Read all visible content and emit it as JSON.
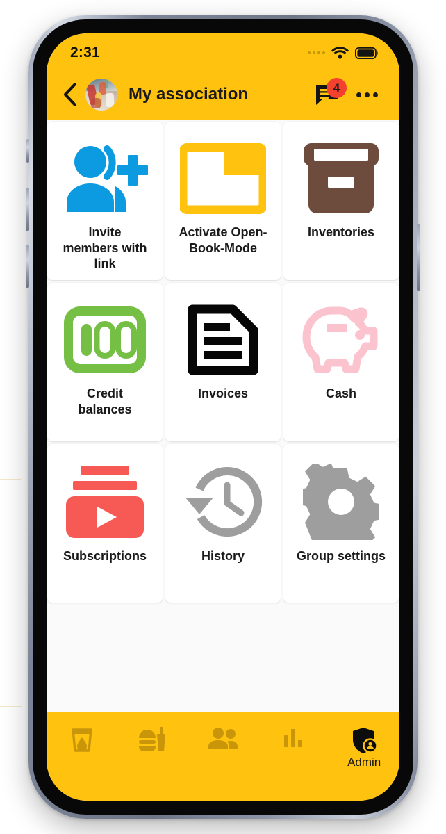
{
  "theme": {
    "brand_yellow": "#ffc20e",
    "nav_icon_amber": "#c9960a",
    "badge_red": "#f4402e",
    "screen_bg": "#fafafa",
    "tile_bg": "#ffffff"
  },
  "status_bar": {
    "time": "2:31",
    "signal_icon": "signal-dots-icon",
    "wifi_icon": "wifi-icon",
    "battery_icon": "battery-full-icon"
  },
  "app_bar": {
    "back_icon": "chevron-left-icon",
    "avatar_icon": "group-avatar-photo",
    "title": "My association",
    "chat_icon": "chat-bubble-icon",
    "chat_badge_count": "4",
    "more_icon": "more-horizontal-icon"
  },
  "grid": {
    "tiles": [
      {
        "label": "Invite\nmembers with\nlink",
        "icon": "person-add-icon",
        "color": "#0c9ae0"
      },
      {
        "label": "Activate Open-\nBook-Mode",
        "icon": "folder-open-icon",
        "color": "#ffc20e"
      },
      {
        "label": "Inventories",
        "icon": "archive-box-icon",
        "color": "#6d4c3d"
      },
      {
        "label": "Credit\nbalances",
        "icon": "banknote-100-icon",
        "color": "#76bf45"
      },
      {
        "label": "Invoices",
        "icon": "document-lines-icon",
        "color": "#000000"
      },
      {
        "label": "Cash",
        "icon": "piggy-bank-icon",
        "color": "#fbc3cd"
      },
      {
        "label": "Subscriptions",
        "icon": "subscriptions-icon",
        "color": "#f75a54"
      },
      {
        "label": "History",
        "icon": "history-clock-icon",
        "color": "#9e9e9e"
      },
      {
        "label": "Group settings",
        "icon": "gear-icon",
        "color": "#9e9e9e"
      }
    ]
  },
  "bottom_nav": {
    "items": [
      {
        "icon": "drink-glass-icon",
        "label": "",
        "active": false
      },
      {
        "icon": "fast-food-icon",
        "label": "",
        "active": false
      },
      {
        "icon": "people-icon",
        "label": "",
        "active": false
      },
      {
        "icon": "bar-chart-icon",
        "label": "",
        "active": false
      },
      {
        "icon": "admin-shield-icon",
        "label": "Admin",
        "active": true
      }
    ]
  }
}
